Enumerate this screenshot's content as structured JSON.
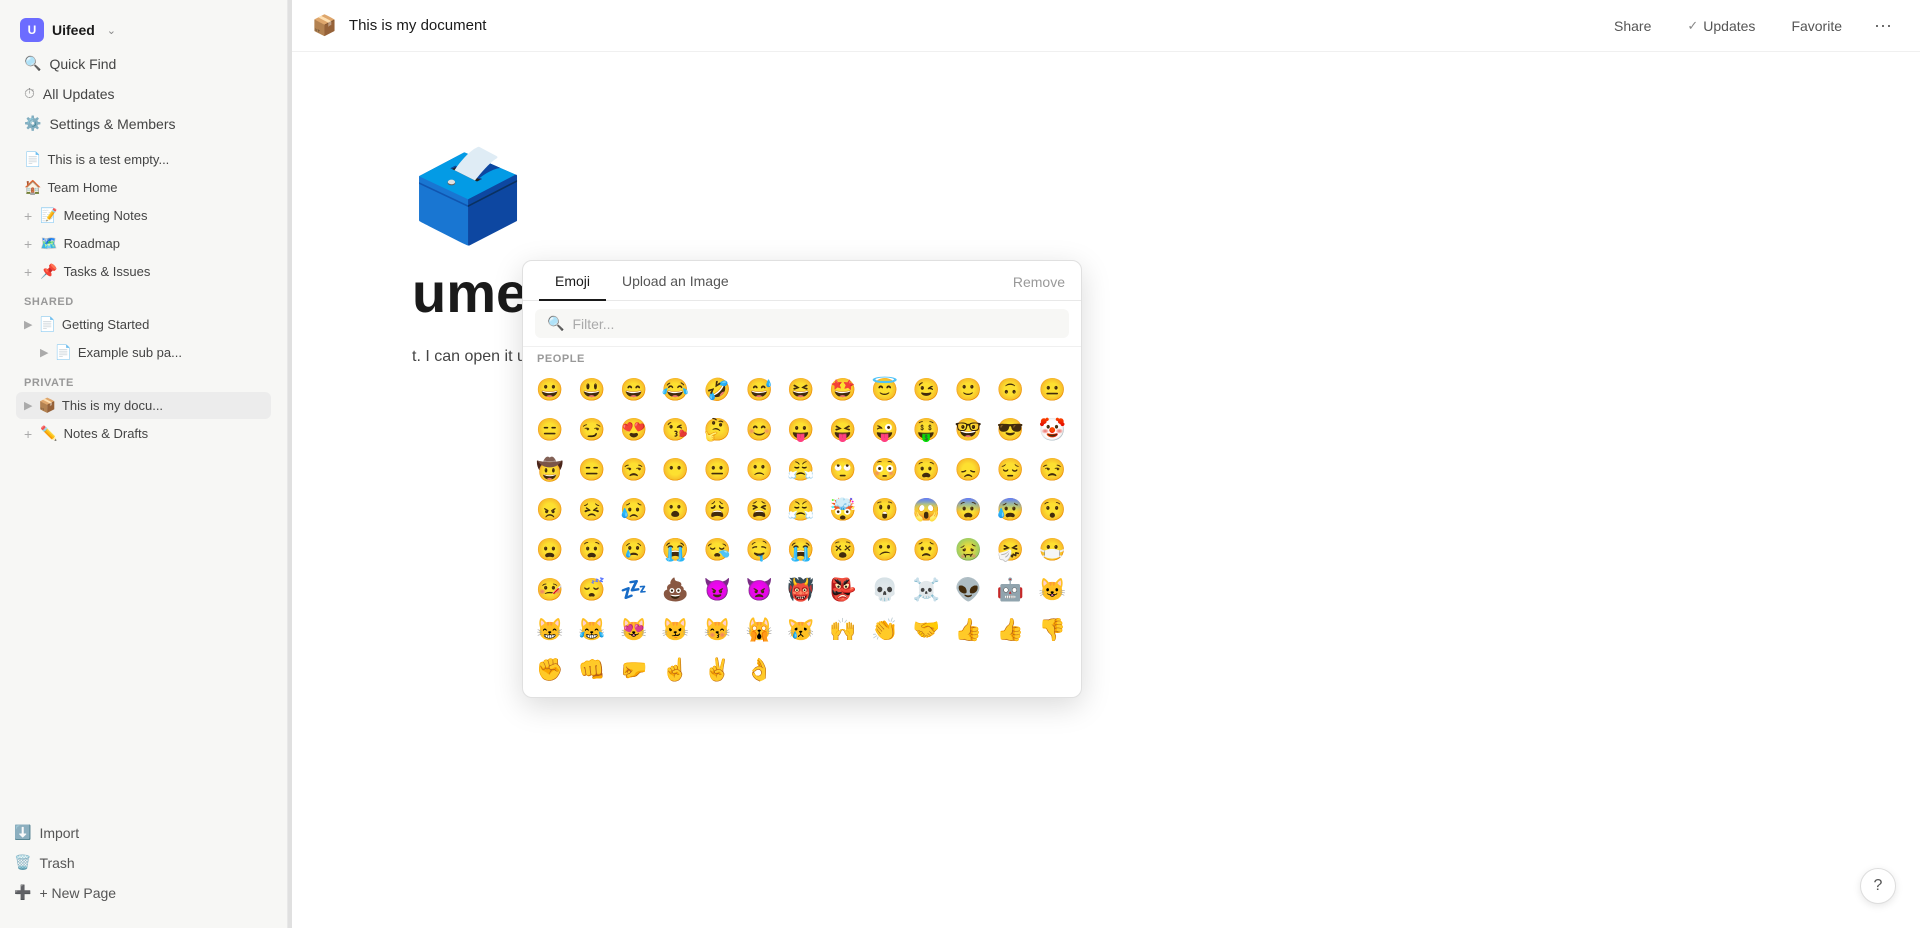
{
  "workspace": {
    "avatar_letter": "U",
    "name": "Uifeed",
    "chevron": "⌄"
  },
  "sidebar": {
    "nav_items": [
      {
        "id": "quick-find",
        "icon": "🔍",
        "label": "Quick Find"
      },
      {
        "id": "all-updates",
        "icon": "⏱",
        "label": "All Updates"
      },
      {
        "id": "settings",
        "icon": "⚙️",
        "label": "Settings & Members"
      }
    ],
    "section_shared": "SHARED",
    "shared_pages": [
      {
        "id": "getting-started",
        "icon": "📄",
        "label": "Getting Started",
        "indent": false,
        "collapse": true
      },
      {
        "id": "example-sub",
        "icon": "📄",
        "label": "Example sub pa...",
        "indent": true,
        "collapse": true
      }
    ],
    "section_private": "PRIVATE",
    "private_pages": [
      {
        "id": "this-is-my-doc",
        "icon": "📦",
        "label": "This is my docu...",
        "active": true,
        "indent": false,
        "collapse": true
      },
      {
        "id": "notes-drafts",
        "icon": "✏️",
        "label": "Notes & Drafts",
        "indent": false
      }
    ],
    "team_home_label": "Team Home",
    "team_home_icon": "🏠",
    "meeting_notes_label": "+ Meeting Notes",
    "meeting_notes_icon": "📝",
    "roadmap_label": "Roadmap",
    "roadmap_icon": "🗺️",
    "tasks_label": "Tasks & Issues",
    "tasks_icon": "📌",
    "import_label": "Import",
    "import_icon": "⬇️",
    "trash_label": "Trash",
    "trash_icon": "🗑️",
    "new_page_label": "+ New Page",
    "new_page_icon": "➕",
    "this_is_test_label": "This is a test empty..."
  },
  "topbar": {
    "doc_icon": "📦",
    "doc_title": "This is my document",
    "share_label": "Share",
    "check_icon": "✓",
    "updates_label": "Updates",
    "favorite_label": "Favorite",
    "more_icon": "···"
  },
  "document": {
    "icon": "📦",
    "title": "ument",
    "body_text": "t. I can open it up."
  },
  "emoji_picker": {
    "tab_emoji": "Emoji",
    "tab_upload": "Upload an Image",
    "tab_remove": "Remove",
    "search_placeholder": "Filter...",
    "category_label": "PEOPLE",
    "emojis": [
      "😀",
      "😃",
      "😄",
      "😂",
      "🤣",
      "😅",
      "😆",
      "🤩",
      "😇",
      "😉",
      "🙂",
      "🙃",
      "😐",
      "😑",
      "😏",
      "😍",
      "😘",
      "🤔",
      "😊",
      "😛",
      "😝",
      "😜",
      "🤑",
      "🤓",
      "😎",
      "🤡",
      "🤠",
      "😑",
      "😒",
      "😶",
      "😐",
      "🙁",
      "😤",
      "🙄",
      "😳",
      "😧",
      "😞",
      "😔",
      "😒",
      "😠",
      "😣",
      "😥",
      "😮",
      "😩",
      "😫",
      "😤",
      "🤯",
      "😲",
      "😱",
      "😨",
      "😰",
      "😯",
      "😦",
      "😧",
      "😢",
      "😭",
      "😪",
      "🤤",
      "😭",
      "😵",
      "😕",
      "😟",
      "🤢",
      "🤧",
      "😷",
      "🤒",
      "😴",
      "💤",
      "💩",
      "😈",
      "👿",
      "👹",
      "👺",
      "💀",
      "☠️",
      "👽",
      "🤖",
      "😺",
      "😸",
      "😹",
      "😻",
      "😼",
      "😽",
      "🙀",
      "😿",
      "🙌",
      "👏",
      "🤝",
      "👍",
      "👍",
      "👎",
      "✊",
      "👊",
      "🤛",
      "☝️",
      "✌️",
      "👌"
    ]
  },
  "help": {
    "icon": "?"
  }
}
